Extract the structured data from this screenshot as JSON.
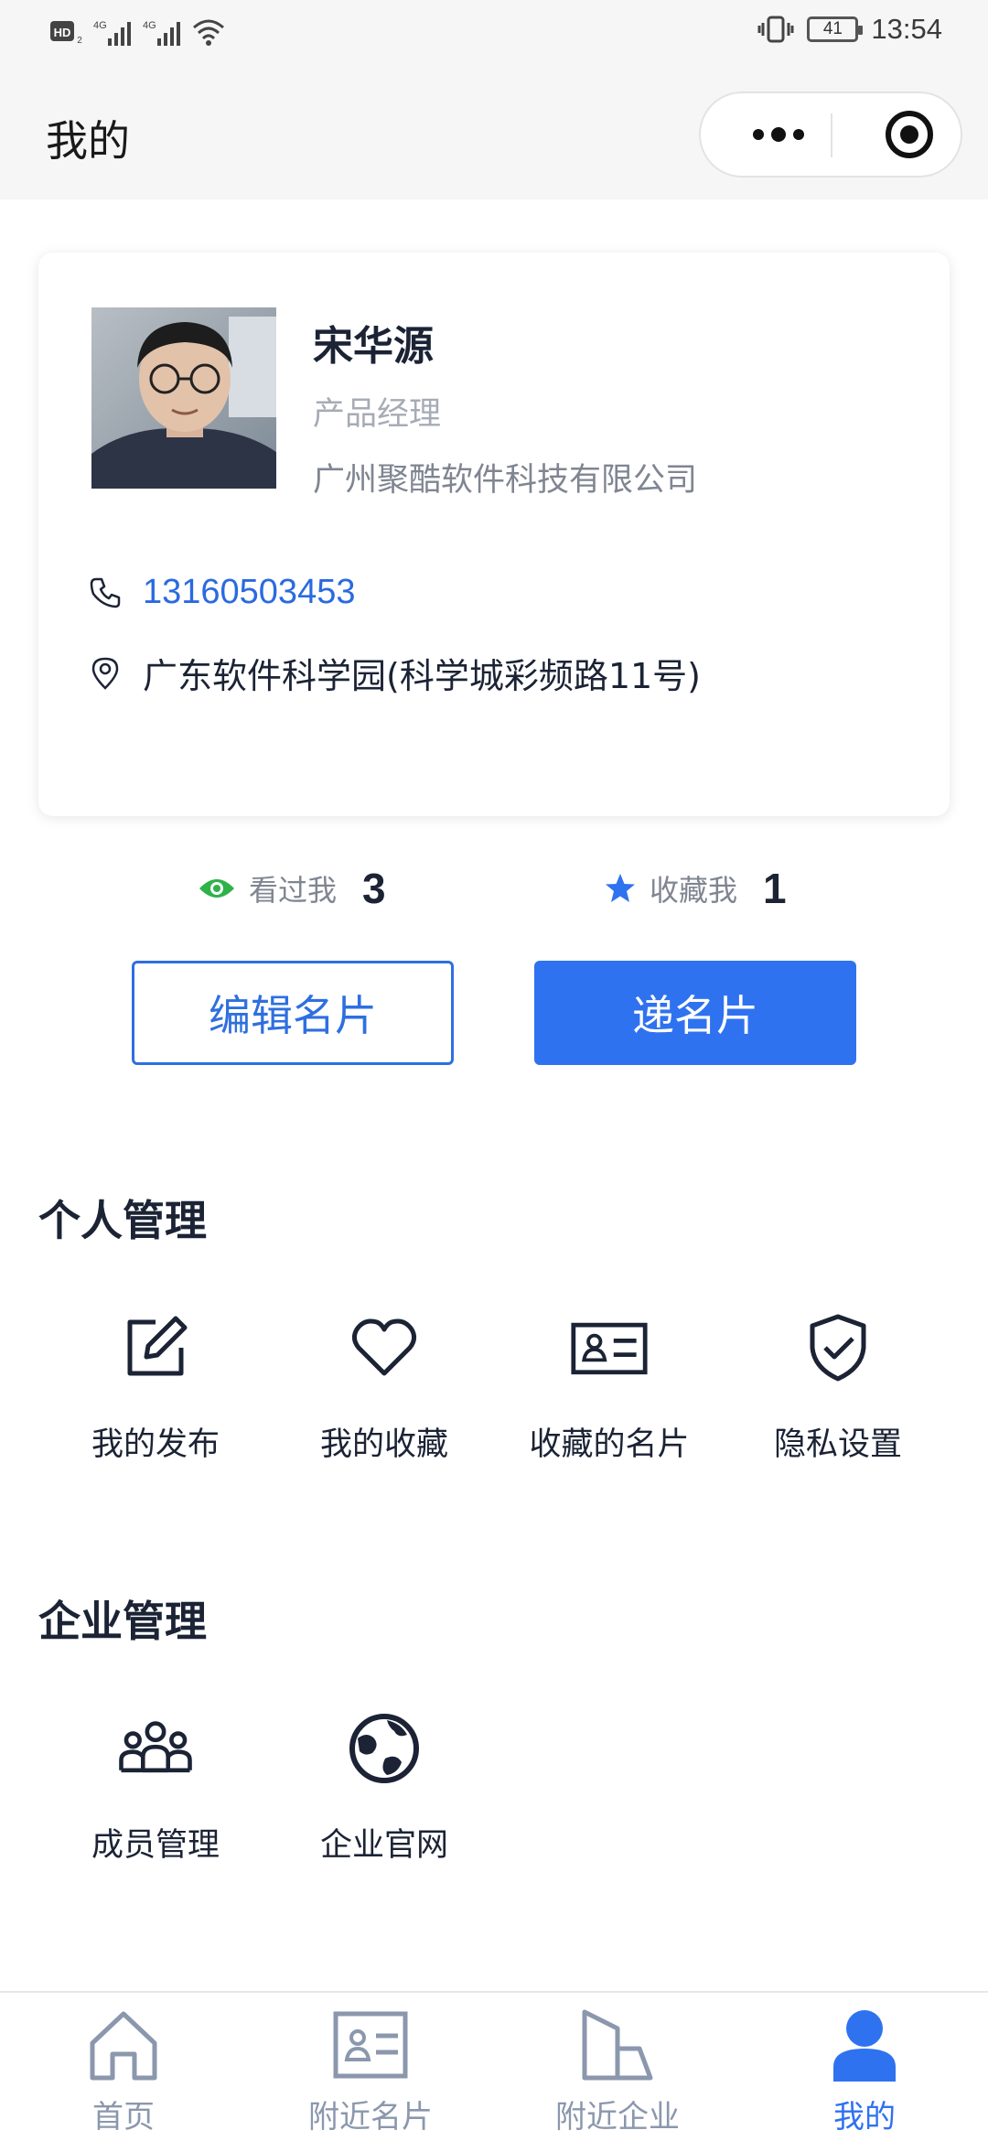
{
  "status_bar": {
    "left": "HD 4G 4G",
    "battery": "41",
    "time": "13:54"
  },
  "header": {
    "title": "我的",
    "more_icon": "more-dots-icon",
    "close_icon": "target-circle-icon"
  },
  "profile": {
    "name": "宋华源",
    "title": "产品经理",
    "company": "广州聚酷软件科技有限公司",
    "phone": "13160503453",
    "address": "广东软件科学园(科学城彩频路11号)"
  },
  "stats": {
    "viewed_label": "看过我",
    "viewed_count": "3",
    "fav_label": "收藏我",
    "fav_count": "1"
  },
  "actions": {
    "edit_label": "编辑名片",
    "share_label": "递名片"
  },
  "personal": {
    "title": "个人管理",
    "items": [
      {
        "label": "我的发布",
        "icon": "edit-icon"
      },
      {
        "label": "我的收藏",
        "icon": "heart-icon"
      },
      {
        "label": "收藏的名片",
        "icon": "id-card-icon"
      },
      {
        "label": "隐私设置",
        "icon": "shield-check-icon"
      }
    ]
  },
  "enterprise": {
    "title": "企业管理",
    "items": [
      {
        "label": "成员管理",
        "icon": "team-icon"
      },
      {
        "label": "企业官网",
        "icon": "globe-icon"
      }
    ]
  },
  "tabs": [
    {
      "label": "首页",
      "icon": "home-icon"
    },
    {
      "label": "附近名片",
      "icon": "card-icon"
    },
    {
      "label": "附近企业",
      "icon": "building-icon"
    },
    {
      "label": "我的",
      "icon": "user-icon",
      "active": true
    }
  ],
  "colors": {
    "accent": "#2f72f0",
    "phone": "#2a6ae0",
    "eye_green": "#2fb24a",
    "text_dark": "#1b2335"
  }
}
